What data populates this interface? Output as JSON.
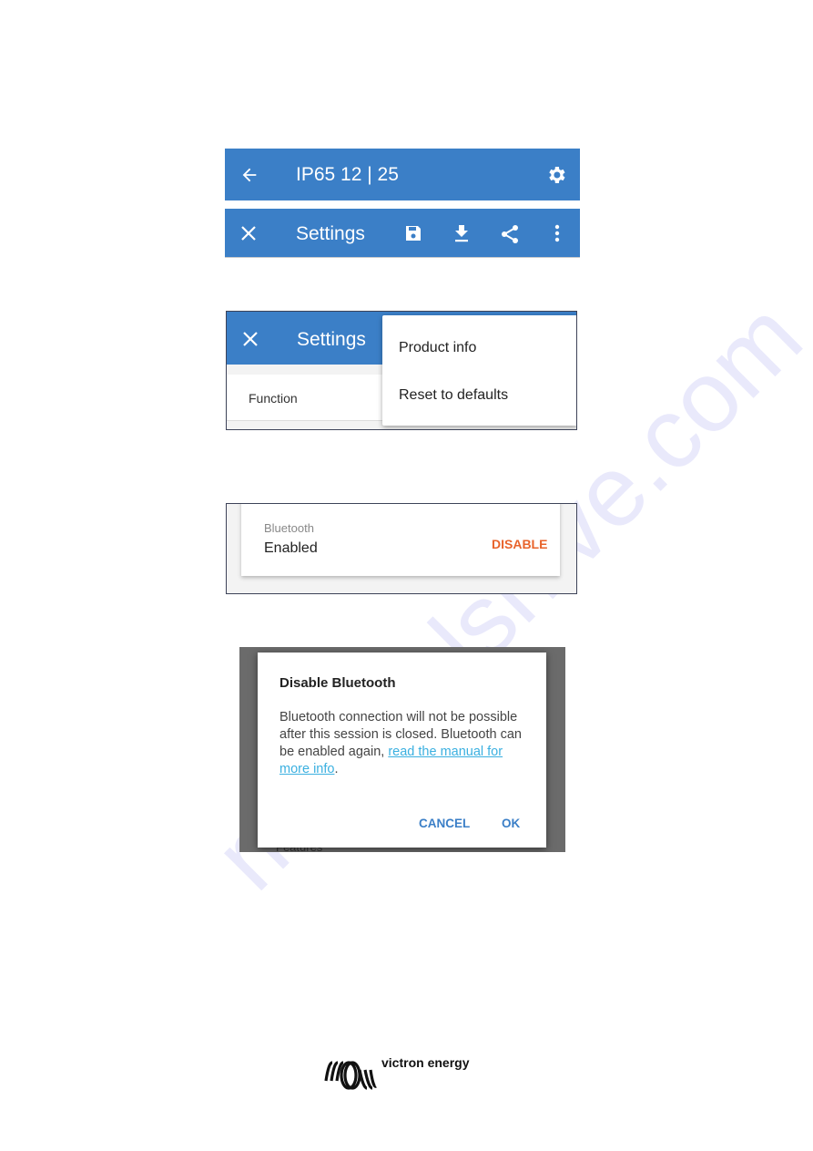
{
  "screen1": {
    "title": "IP65 12 | 25",
    "back_icon": "arrow-left-icon",
    "settings_icon": "gear-icon"
  },
  "screen2": {
    "title": "Settings",
    "icons": [
      "close-icon",
      "save-icon",
      "download-icon",
      "share-icon",
      "more-vert-icon"
    ]
  },
  "screen3": {
    "title": "Settings",
    "row_label": "Function",
    "menu_items": [
      "Product info",
      "Reset to defaults"
    ]
  },
  "screen4": {
    "label": "Bluetooth",
    "value": "Enabled",
    "action": "DISABLE",
    "action_color": "#e8632b"
  },
  "dialog": {
    "title": "Disable Bluetooth",
    "body": "Bluetooth connection will not be possible after this session is closed. Bluetooth can be enabled again, ",
    "link": "read the manual for more info",
    "body_end": ".",
    "cancel": "CANCEL",
    "ok": "OK",
    "behind_text": "Features"
  },
  "logo": {
    "text": "victron energy"
  },
  "watermark": "manualshive.com",
  "colors": {
    "appbar": "#3b7fc7",
    "accent": "#3b7fc7",
    "link": "#3bb0e0"
  }
}
